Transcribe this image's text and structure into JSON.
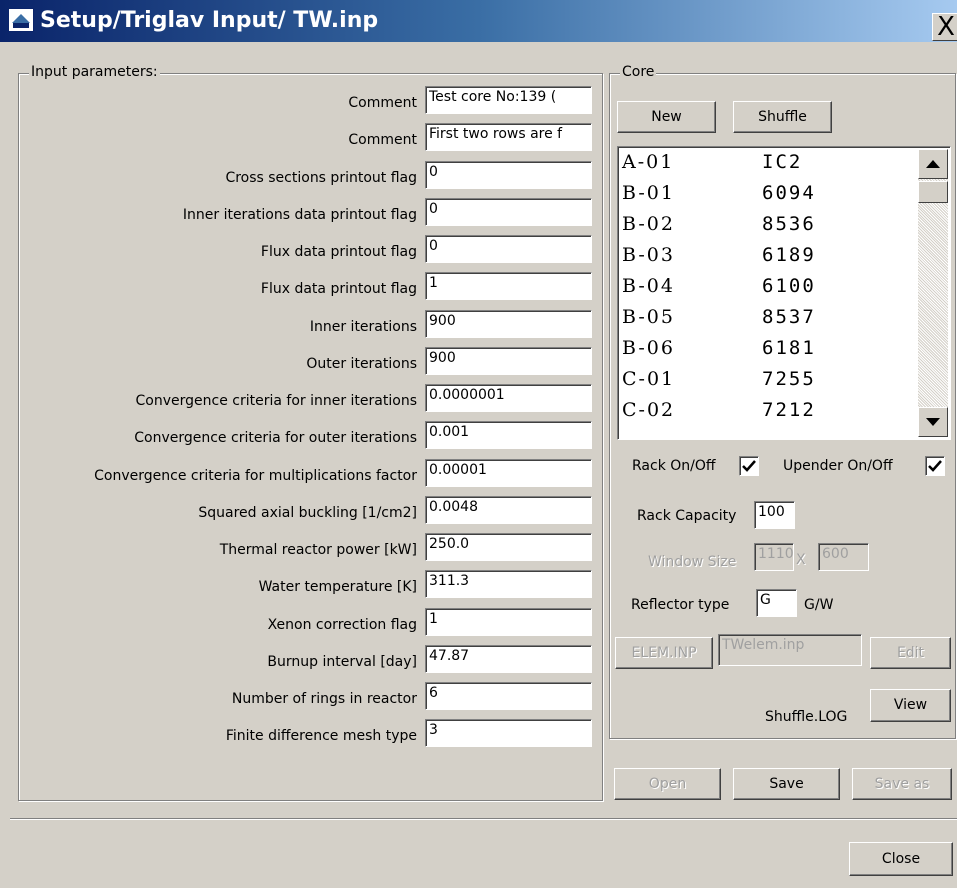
{
  "window": {
    "title": "Setup/Triglav Input/ TW.inp",
    "close_symbol": "X"
  },
  "input_group": {
    "legend": "Input parameters:"
  },
  "params": [
    {
      "label": "Comment",
      "value": "Test core No:139 ("
    },
    {
      "label": "Comment",
      "value": "First two rows are f"
    },
    {
      "label": "Cross sections printout flag",
      "value": "0"
    },
    {
      "label": "Inner iterations data printout flag",
      "value": "0"
    },
    {
      "label": "Flux data printout flag",
      "value": "0"
    },
    {
      "label": "Flux data printout flag",
      "value": "1"
    },
    {
      "label": "Inner iterations",
      "value": "900"
    },
    {
      "label": "Outer iterations",
      "value": "900"
    },
    {
      "label": "Convergence criteria for inner iterations",
      "value": "0.0000001"
    },
    {
      "label": "Convergence criteria for outer iterations",
      "value": "0.001"
    },
    {
      "label": "Convergence criteria for multiplications factor",
      "value": "0.00001"
    },
    {
      "label": "Squared axial buckling [1/cm2]",
      "value": "0.0048"
    },
    {
      "label": "Thermal reactor power [kW]",
      "value": "250.0"
    },
    {
      "label": "Water temperature [K]",
      "value": "311.3"
    },
    {
      "label": "Xenon correction flag",
      "value": "1"
    },
    {
      "label": "Burnup interval [day]",
      "value": "47.87"
    },
    {
      "label": "Number of rings in reactor",
      "value": "6"
    },
    {
      "label": "Finite difference mesh type",
      "value": "3"
    }
  ],
  "core": {
    "legend": "Core",
    "new_label": "New",
    "shuffle_label": "Shuffle",
    "list": [
      {
        "pos": "A-01",
        "element": "IC2"
      },
      {
        "pos": "B-01",
        "element": "6094"
      },
      {
        "pos": "B-02",
        "element": "8536"
      },
      {
        "pos": "B-03",
        "element": "6189"
      },
      {
        "pos": "B-04",
        "element": "6100"
      },
      {
        "pos": "B-05",
        "element": "8537"
      },
      {
        "pos": "B-06",
        "element": "6181"
      },
      {
        "pos": "C-01",
        "element": "7255"
      },
      {
        "pos": "C-02",
        "element": "7212"
      }
    ],
    "rack_label": "Rack On/Off",
    "rack_checked": true,
    "upender_label": "Upender On/Off",
    "upender_checked": true,
    "rack_capacity_label": "Rack Capacity",
    "rack_capacity_value": "100",
    "window_size_label": "Window Size",
    "window_w": "1110",
    "window_x": "X",
    "window_h": "600",
    "reflector_label": "Reflector type",
    "reflector_value": "G",
    "reflector_hint": "G/W",
    "elem_button": "ELEM.INP",
    "elem_file": "TWelem.inp",
    "edit_label": "Edit",
    "shuffle_log_label": "Shuffle.LOG",
    "view_label": "View"
  },
  "file_buttons": {
    "open": "Open",
    "save": "Save",
    "save_as": "Save as"
  },
  "close_label": "Close"
}
